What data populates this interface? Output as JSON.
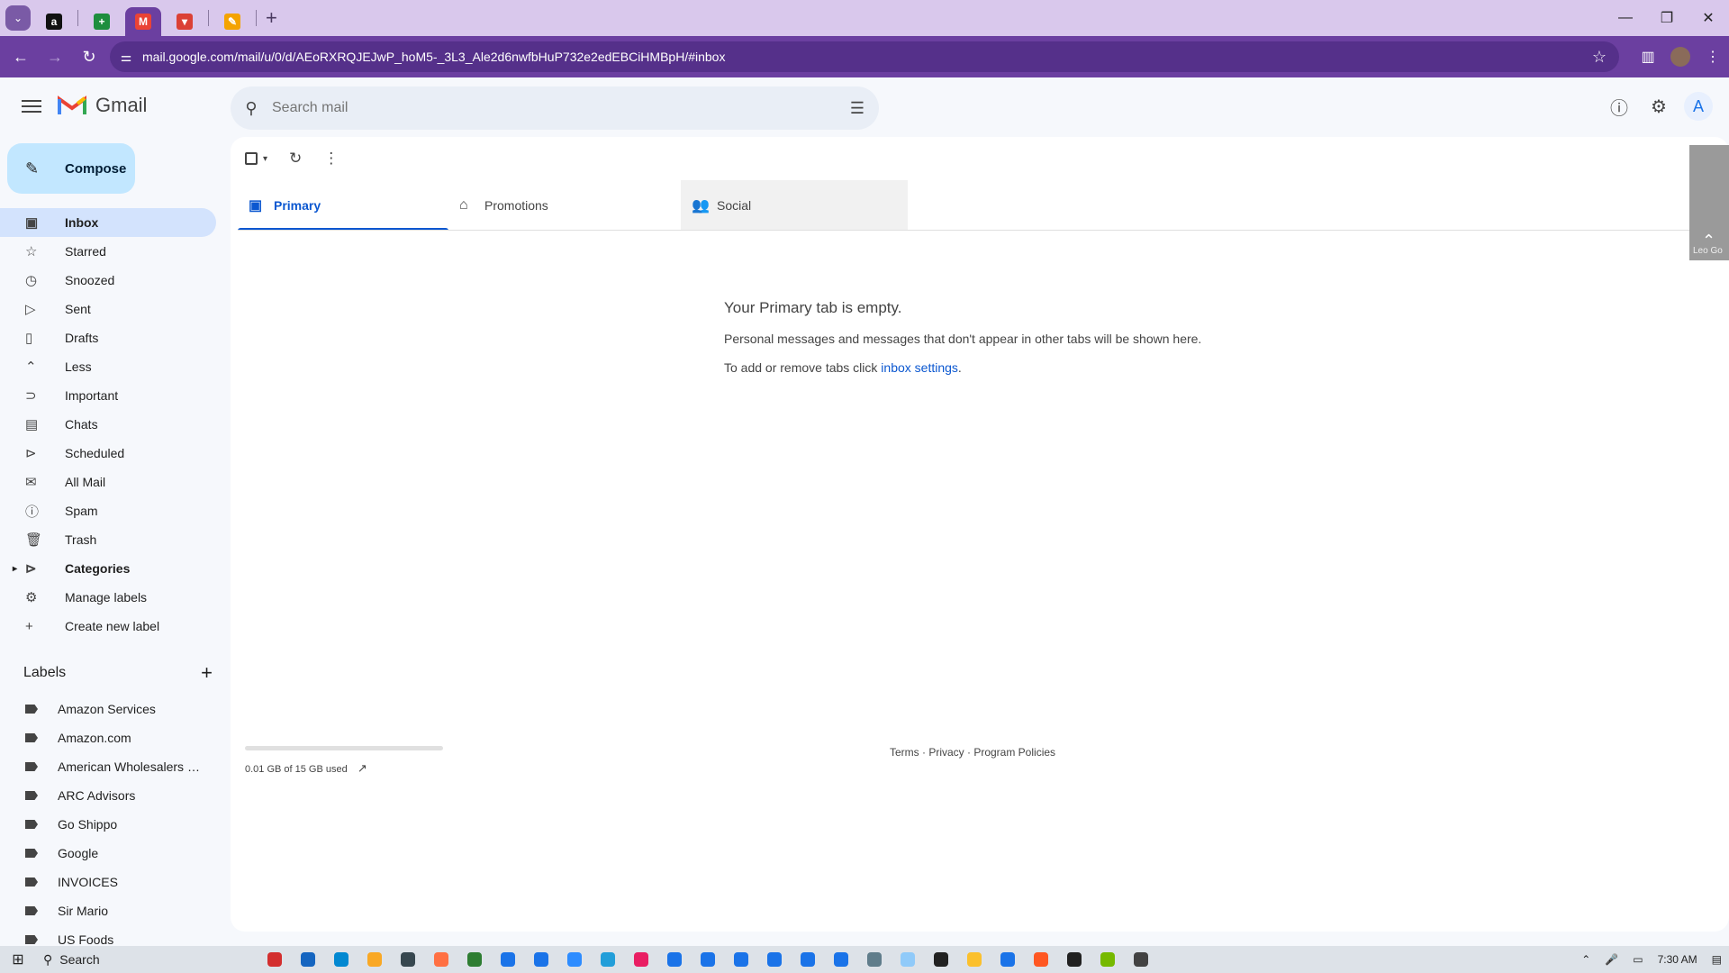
{
  "browser": {
    "url": "mail.google.com/mail/u/0/d/AEoRXRQJEJwP_hoM5-_3L3_Ale2d6nwfbHuP732e2edEBCiHMBpH/#inbox",
    "tabs": [
      {
        "icon": "amazon-icon",
        "glyph": "a",
        "color": "#111111"
      },
      {
        "icon": "sheets-icon",
        "glyph": "+",
        "color": "#1e8e3e"
      },
      {
        "icon": "gmail-icon",
        "glyph": "M",
        "color": "#ea4335"
      },
      {
        "icon": "todoist-icon",
        "glyph": "▾",
        "color": "#db4035"
      },
      {
        "icon": "app-icon",
        "glyph": "✎",
        "color": "#f4a300"
      }
    ]
  },
  "gmail": {
    "brand": "Gmail",
    "search_placeholder": "Search mail",
    "avatar_letter": "A",
    "compose_label": "Compose",
    "nav": [
      {
        "label": "Inbox",
        "icon": "inbox-icon",
        "glyph": "▣",
        "active": true
      },
      {
        "label": "Starred",
        "icon": "star-icon",
        "glyph": "☆"
      },
      {
        "label": "Snoozed",
        "icon": "clock-icon",
        "glyph": "◷"
      },
      {
        "label": "Sent",
        "icon": "send-icon",
        "glyph": "▷"
      },
      {
        "label": "Drafts",
        "icon": "draft-icon",
        "glyph": "▯"
      },
      {
        "label": "Less",
        "icon": "chevron-up-icon",
        "glyph": "⌃"
      },
      {
        "label": "Important",
        "icon": "important-icon",
        "glyph": "⊃"
      },
      {
        "label": "Chats",
        "icon": "chat-icon",
        "glyph": "▤"
      },
      {
        "label": "Scheduled",
        "icon": "scheduled-icon",
        "glyph": "⊳"
      },
      {
        "label": "All Mail",
        "icon": "all-mail-icon",
        "glyph": "✉"
      },
      {
        "label": "Spam",
        "icon": "spam-icon",
        "glyph": "ⓘ"
      },
      {
        "label": "Trash",
        "icon": "trash-icon",
        "glyph": "🗑"
      },
      {
        "label": "Categories",
        "icon": "label-icon",
        "glyph": "⊳",
        "bold": true
      },
      {
        "label": "Manage labels",
        "icon": "gear-icon",
        "glyph": "⚙"
      },
      {
        "label": "Create new label",
        "icon": "plus-icon",
        "glyph": "+"
      }
    ],
    "labels_heading": "Labels",
    "labels": [
      "Amazon Services",
      "Amazon.com",
      "American Wholesalers L...",
      "ARC Advisors",
      "Go Shippo",
      "Google",
      "INVOICES",
      "Sir Mario",
      "US Foods"
    ],
    "tabs": [
      {
        "label": "Primary",
        "icon": "inbox-tab-icon",
        "glyph": "▣"
      },
      {
        "label": "Promotions",
        "icon": "tag-icon",
        "glyph": "⌂"
      },
      {
        "label": "Social",
        "icon": "people-icon",
        "glyph": "👥"
      }
    ],
    "empty_title": "Your Primary tab is empty.",
    "empty_line1": "Personal messages and messages that don't appear in other tabs will be shown here.",
    "empty_line2_prefix": "To add or remove tabs click ",
    "empty_link": "inbox settings",
    "empty_suffix": ".",
    "storage_text": "0.01 GB of 15 GB used",
    "footer": "Terms · Privacy · Program Policies",
    "side_name": "Leo Go"
  },
  "taskbar": {
    "search_label": "Search",
    "time": "7:30 AM",
    "apps": [
      "#d32f2f",
      "#1565c0",
      "#0288d1",
      "#f9a825",
      "#37474f",
      "#ff7043",
      "#2e7d32",
      "#1a73e8",
      "#1a73e8",
      "#2d8cff",
      "#229ed9",
      "#e91e63",
      "#1a73e8",
      "#1a73e8",
      "#1a73e8",
      "#1a73e8",
      "#1a73e8",
      "#1a73e8",
      "#607d8b",
      "#90caf9",
      "#212121",
      "#fbc02d",
      "#1a73e8",
      "#ff5722",
      "#212121",
      "#76b900",
      "#424242"
    ]
  }
}
